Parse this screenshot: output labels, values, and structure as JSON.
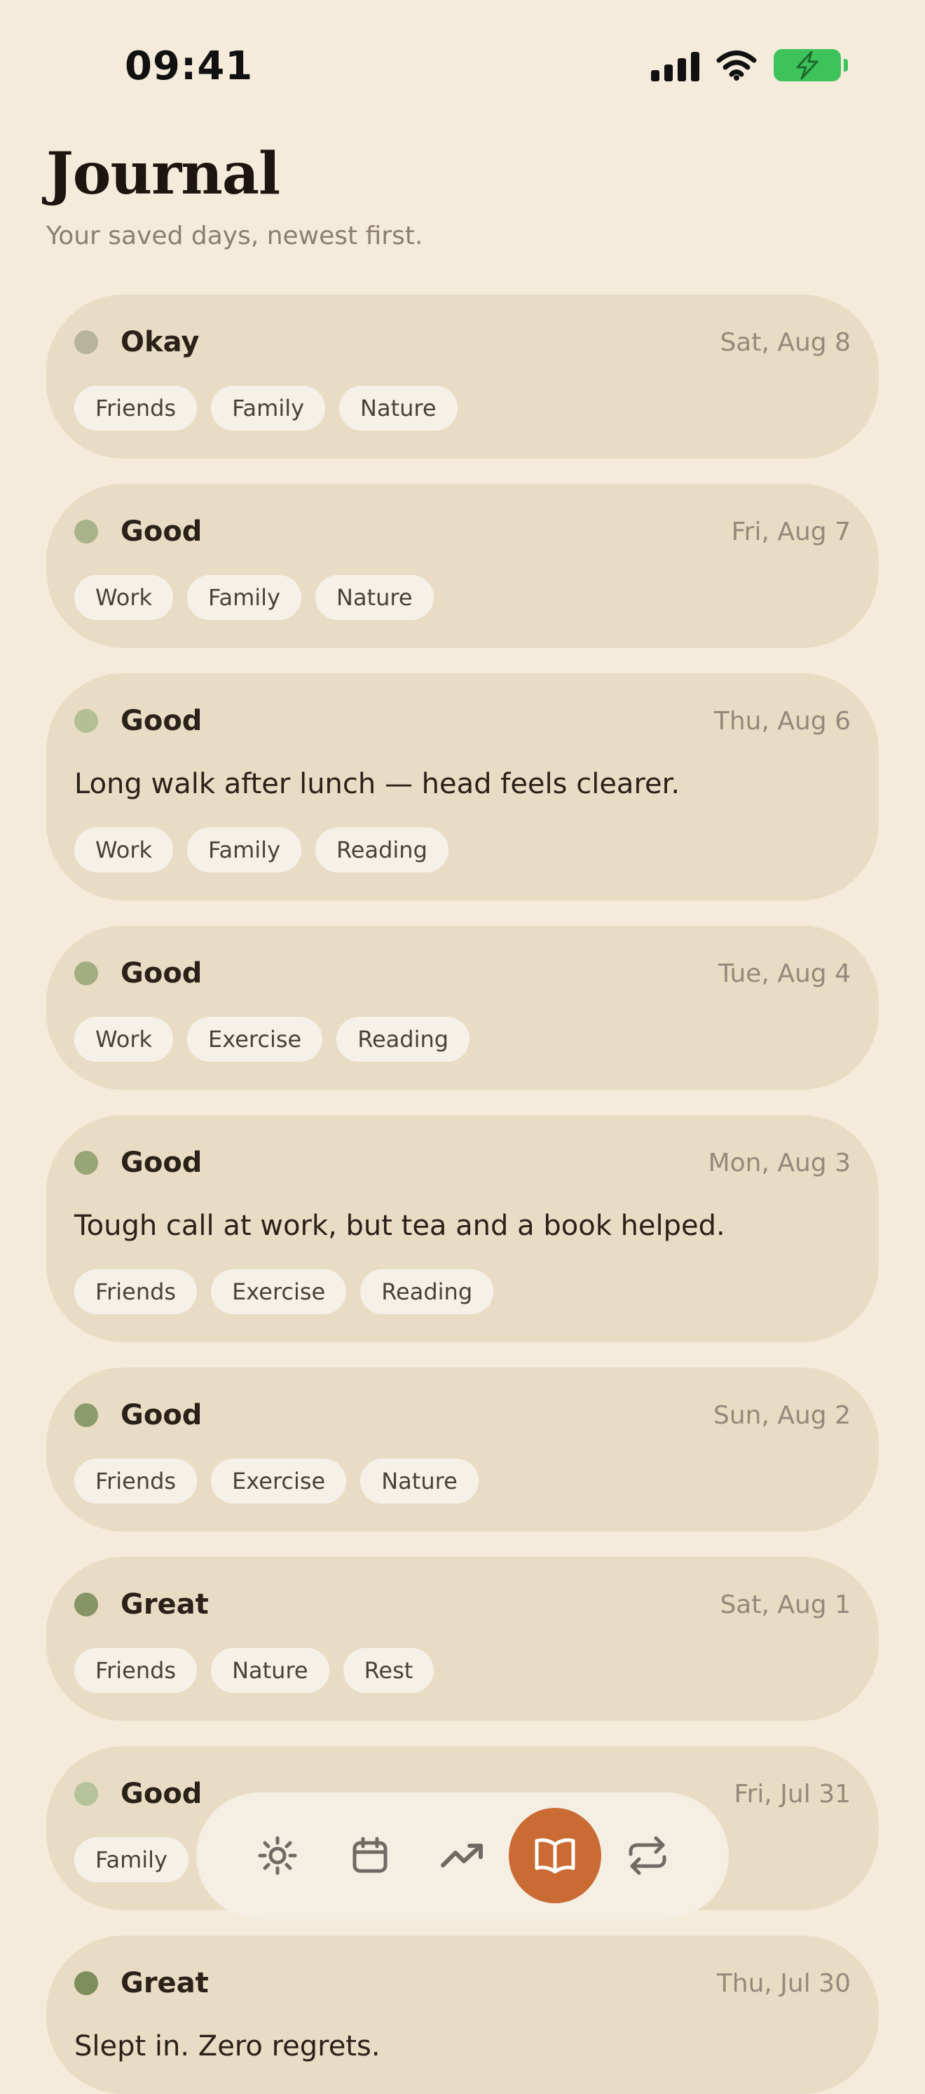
{
  "status": {
    "time": "09:41"
  },
  "header": {
    "title": "Journal",
    "subtitle": "Your saved days, newest first."
  },
  "entries": [
    {
      "mood": "Okay",
      "mood_color": "#b7b49b",
      "date": "Sat, Aug 8",
      "note": "",
      "tags": [
        "Friends",
        "Family",
        "Nature"
      ]
    },
    {
      "mood": "Good",
      "mood_color": "#a9b38b",
      "date": "Fri, Aug 7",
      "note": "",
      "tags": [
        "Work",
        "Family",
        "Nature"
      ]
    },
    {
      "mood": "Good",
      "mood_color": "#b5bf95",
      "date": "Thu, Aug 6",
      "note": "Long walk after lunch — head feels clearer.",
      "tags": [
        "Work",
        "Family",
        "Reading"
      ]
    },
    {
      "mood": "Good",
      "mood_color": "#a2ad82",
      "date": "Tue, Aug 4",
      "note": "",
      "tags": [
        "Work",
        "Exercise",
        "Reading"
      ]
    },
    {
      "mood": "Good",
      "mood_color": "#97a577",
      "date": "Mon, Aug 3",
      "note": "Tough call at work, but tea and a book helped.",
      "tags": [
        "Friends",
        "Exercise",
        "Reading"
      ]
    },
    {
      "mood": "Good",
      "mood_color": "#8c9b6c",
      "date": "Sun, Aug 2",
      "note": "",
      "tags": [
        "Friends",
        "Exercise",
        "Nature"
      ]
    },
    {
      "mood": "Great",
      "mood_color": "#869467",
      "date": "Sat, Aug 1",
      "note": "",
      "tags": [
        "Friends",
        "Nature",
        "Rest"
      ]
    },
    {
      "mood": "Good",
      "mood_color": "#b5c29b",
      "date": "Fri, Jul 31",
      "note": "",
      "tags": [
        "Family"
      ]
    },
    {
      "mood": "Great",
      "mood_color": "#7d8d5c",
      "date": "Thu, Jul 30",
      "note": "Slept in. Zero regrets.",
      "tags": []
    }
  ],
  "nav": {
    "items": [
      {
        "icon": "sun-icon"
      },
      {
        "icon": "calendar-icon"
      },
      {
        "icon": "trend-icon"
      },
      {
        "icon": "book-icon",
        "active": true
      },
      {
        "icon": "repeat-icon"
      }
    ],
    "icon_color": "#6f6a63",
    "active_color": "#c96b33"
  }
}
